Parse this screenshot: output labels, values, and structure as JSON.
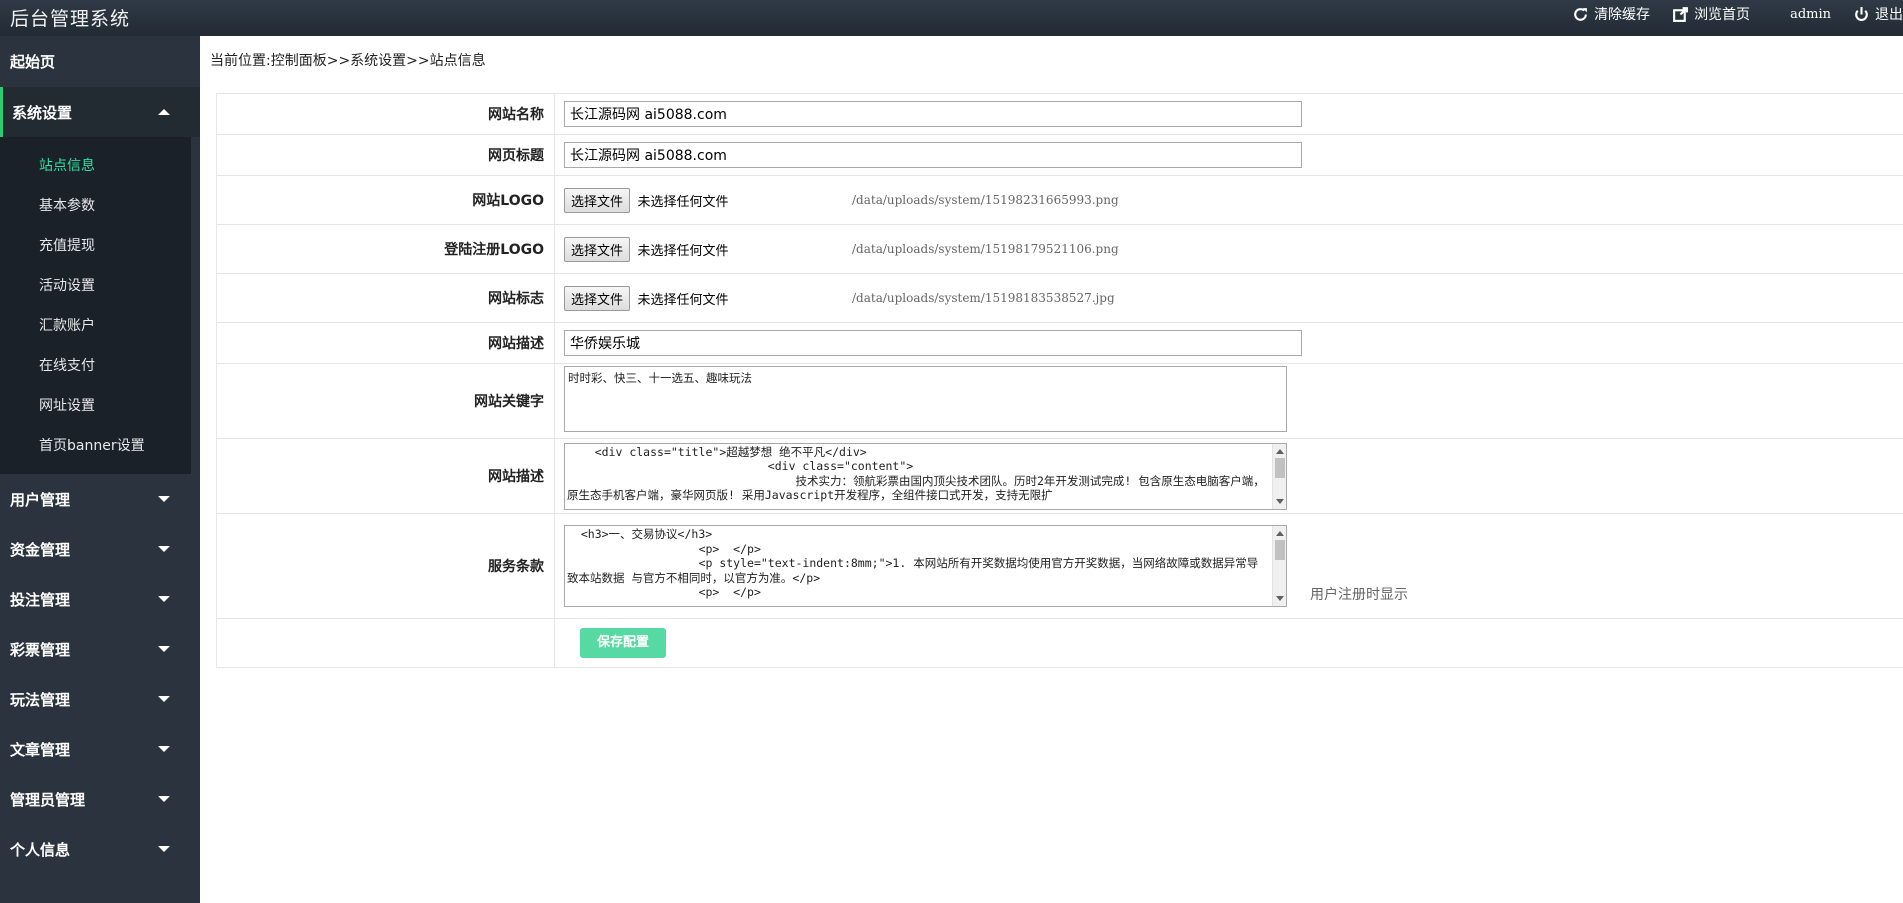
{
  "header": {
    "title": "后台管理系统",
    "clear_cache": "清除缓存",
    "browse_home": "浏览首页",
    "user": "admin",
    "logout": "退出"
  },
  "sidebar": {
    "home": "起始页",
    "active_group": "系统设置",
    "sub_items": [
      "站点信息",
      "基本参数",
      "充值提现",
      "活动设置",
      "汇款账户",
      "在线支付",
      "网址设置",
      "首页banner设置"
    ],
    "groups": [
      "用户管理",
      "资金管理",
      "投注管理",
      "彩票管理",
      "玩法管理",
      "文章管理",
      "管理员管理",
      "个人信息"
    ]
  },
  "breadcrumb": "当前位置:控制面板>>系统设置>>站点信息",
  "form": {
    "site_name_label": "网站名称",
    "site_name_value": "长江源码网 ai5088.com",
    "page_title_label": "网页标题",
    "page_title_value": "长江源码网 ai5088.com",
    "logo_label": "网站LOGO",
    "logo_btn": "选择文件",
    "logo_status": "未选择任何文件",
    "logo_path": "/data/uploads/system/15198231665993.png",
    "login_logo_label": "登陆注册LOGO",
    "login_logo_btn": "选择文件",
    "login_logo_status": "未选择任何文件",
    "login_logo_path": "/data/uploads/system/15198179521106.png",
    "mark_label": "网站标志",
    "mark_btn": "选择文件",
    "mark_status": "未选择任何文件",
    "mark_path": "/data/uploads/system/15198183538527.jpg",
    "desc_label": "网站描述",
    "desc_value": "华侨娱乐城",
    "keywords_label": "网站关键字",
    "keywords_value": "时时彩、快三、十一选五、趣味玩法",
    "desc2_label": "网站描述",
    "desc2_value": "    <div class=\"title\">超越梦想 绝不平凡</div>\n                             <div class=\"content\">\n                                 技术实力：领航彩票由国内顶尖技术团队。历时2年开发测试完成! 包含原生态电脑客户端，原生态手机客户端，豪华网页版! 采用Javascript开发程序，全组件接口式开发，支持无限扩",
    "terms_label": "服务条款",
    "terms_value": "  <h3>一、交易协议</h3>\n                   <p>  </p>\n                   <p style=\"text-indent:8mm;\">1. 本网站所有开奖数据均使用官方开奖数据，当网络故障或数据异常导致本站数据 与官方不相同时，以官方为准。</p>\n                   <p>  </p>",
    "terms_hint": "用户注册时显示",
    "save": "保存配置"
  }
}
